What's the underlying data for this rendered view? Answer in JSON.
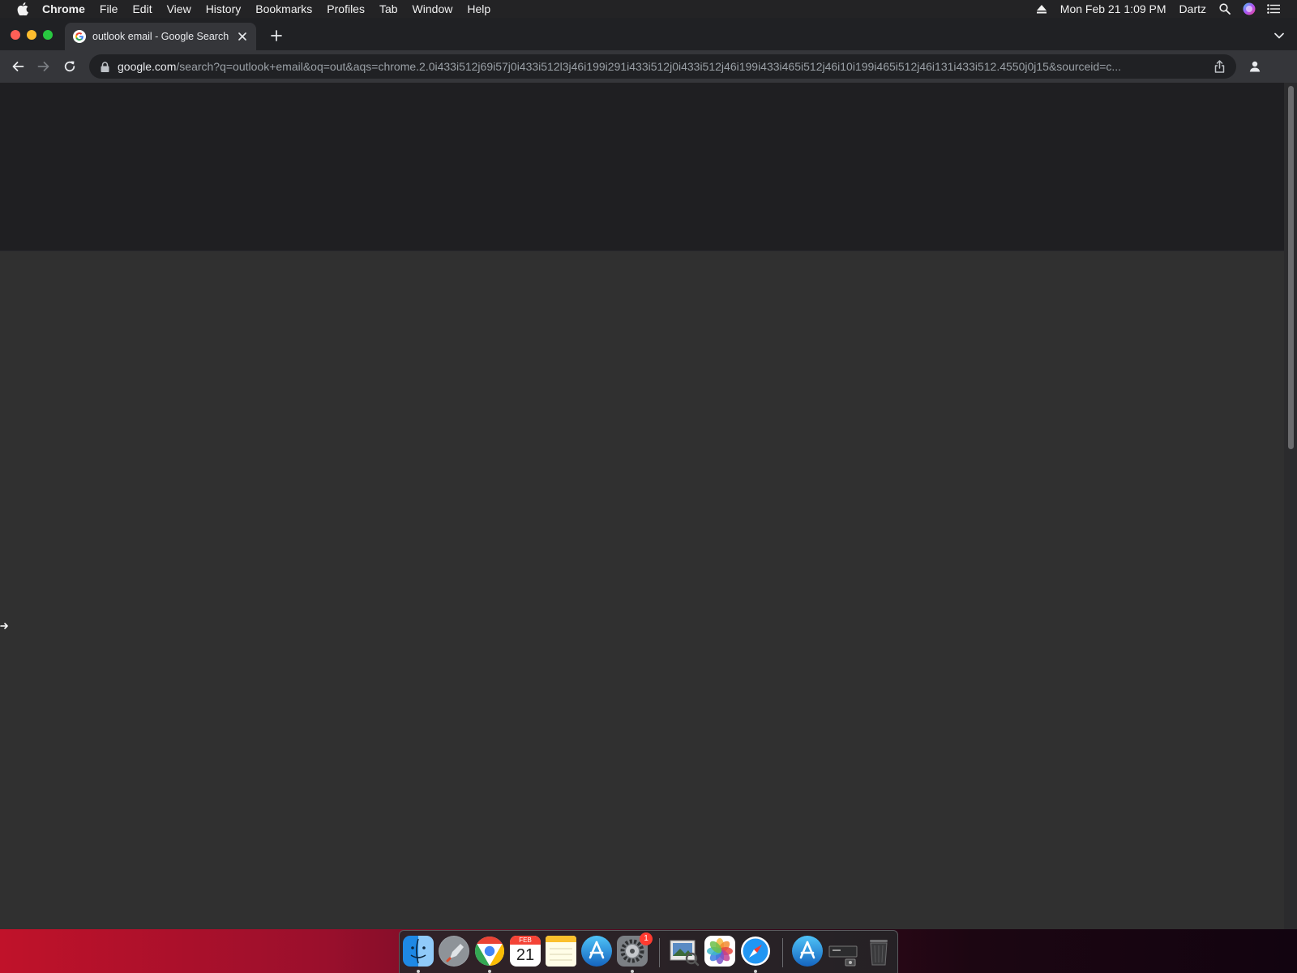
{
  "menubar": {
    "app_name": "Chrome",
    "items": [
      "File",
      "Edit",
      "View",
      "History",
      "Bookmarks",
      "Profiles",
      "Tab",
      "Window",
      "Help"
    ],
    "datetime": "Mon Feb 21  1:09 PM",
    "user": "Dartz"
  },
  "tab": {
    "title": "outlook email - Google Search"
  },
  "omnibox": {
    "host": "google.com",
    "path": "/search?q=outlook+email&oq=out&aqs=chrome.2.0i433i512j69i57j0i433i512l3j46i199i291i433i512j0i433i512j46i199i433i465i512j46i10i199i465i512j46i131i433i512.4550j0j15&sourceid=c..."
  },
  "dock": {
    "calendar_month": "FEB",
    "calendar_day": "21",
    "settings_badge": "1",
    "apps": [
      "finder",
      "launchpad",
      "chrome",
      "calendar",
      "notes",
      "app-store",
      "system-preferences",
      "preview",
      "photos",
      "safari",
      "app-store",
      "screenshot",
      "trash"
    ]
  },
  "colors": {
    "menubar": "#232325",
    "tabstrip": "#202124",
    "toolbar": "#35363a",
    "page_top": "#1f1f22",
    "page_main": "#303030"
  }
}
